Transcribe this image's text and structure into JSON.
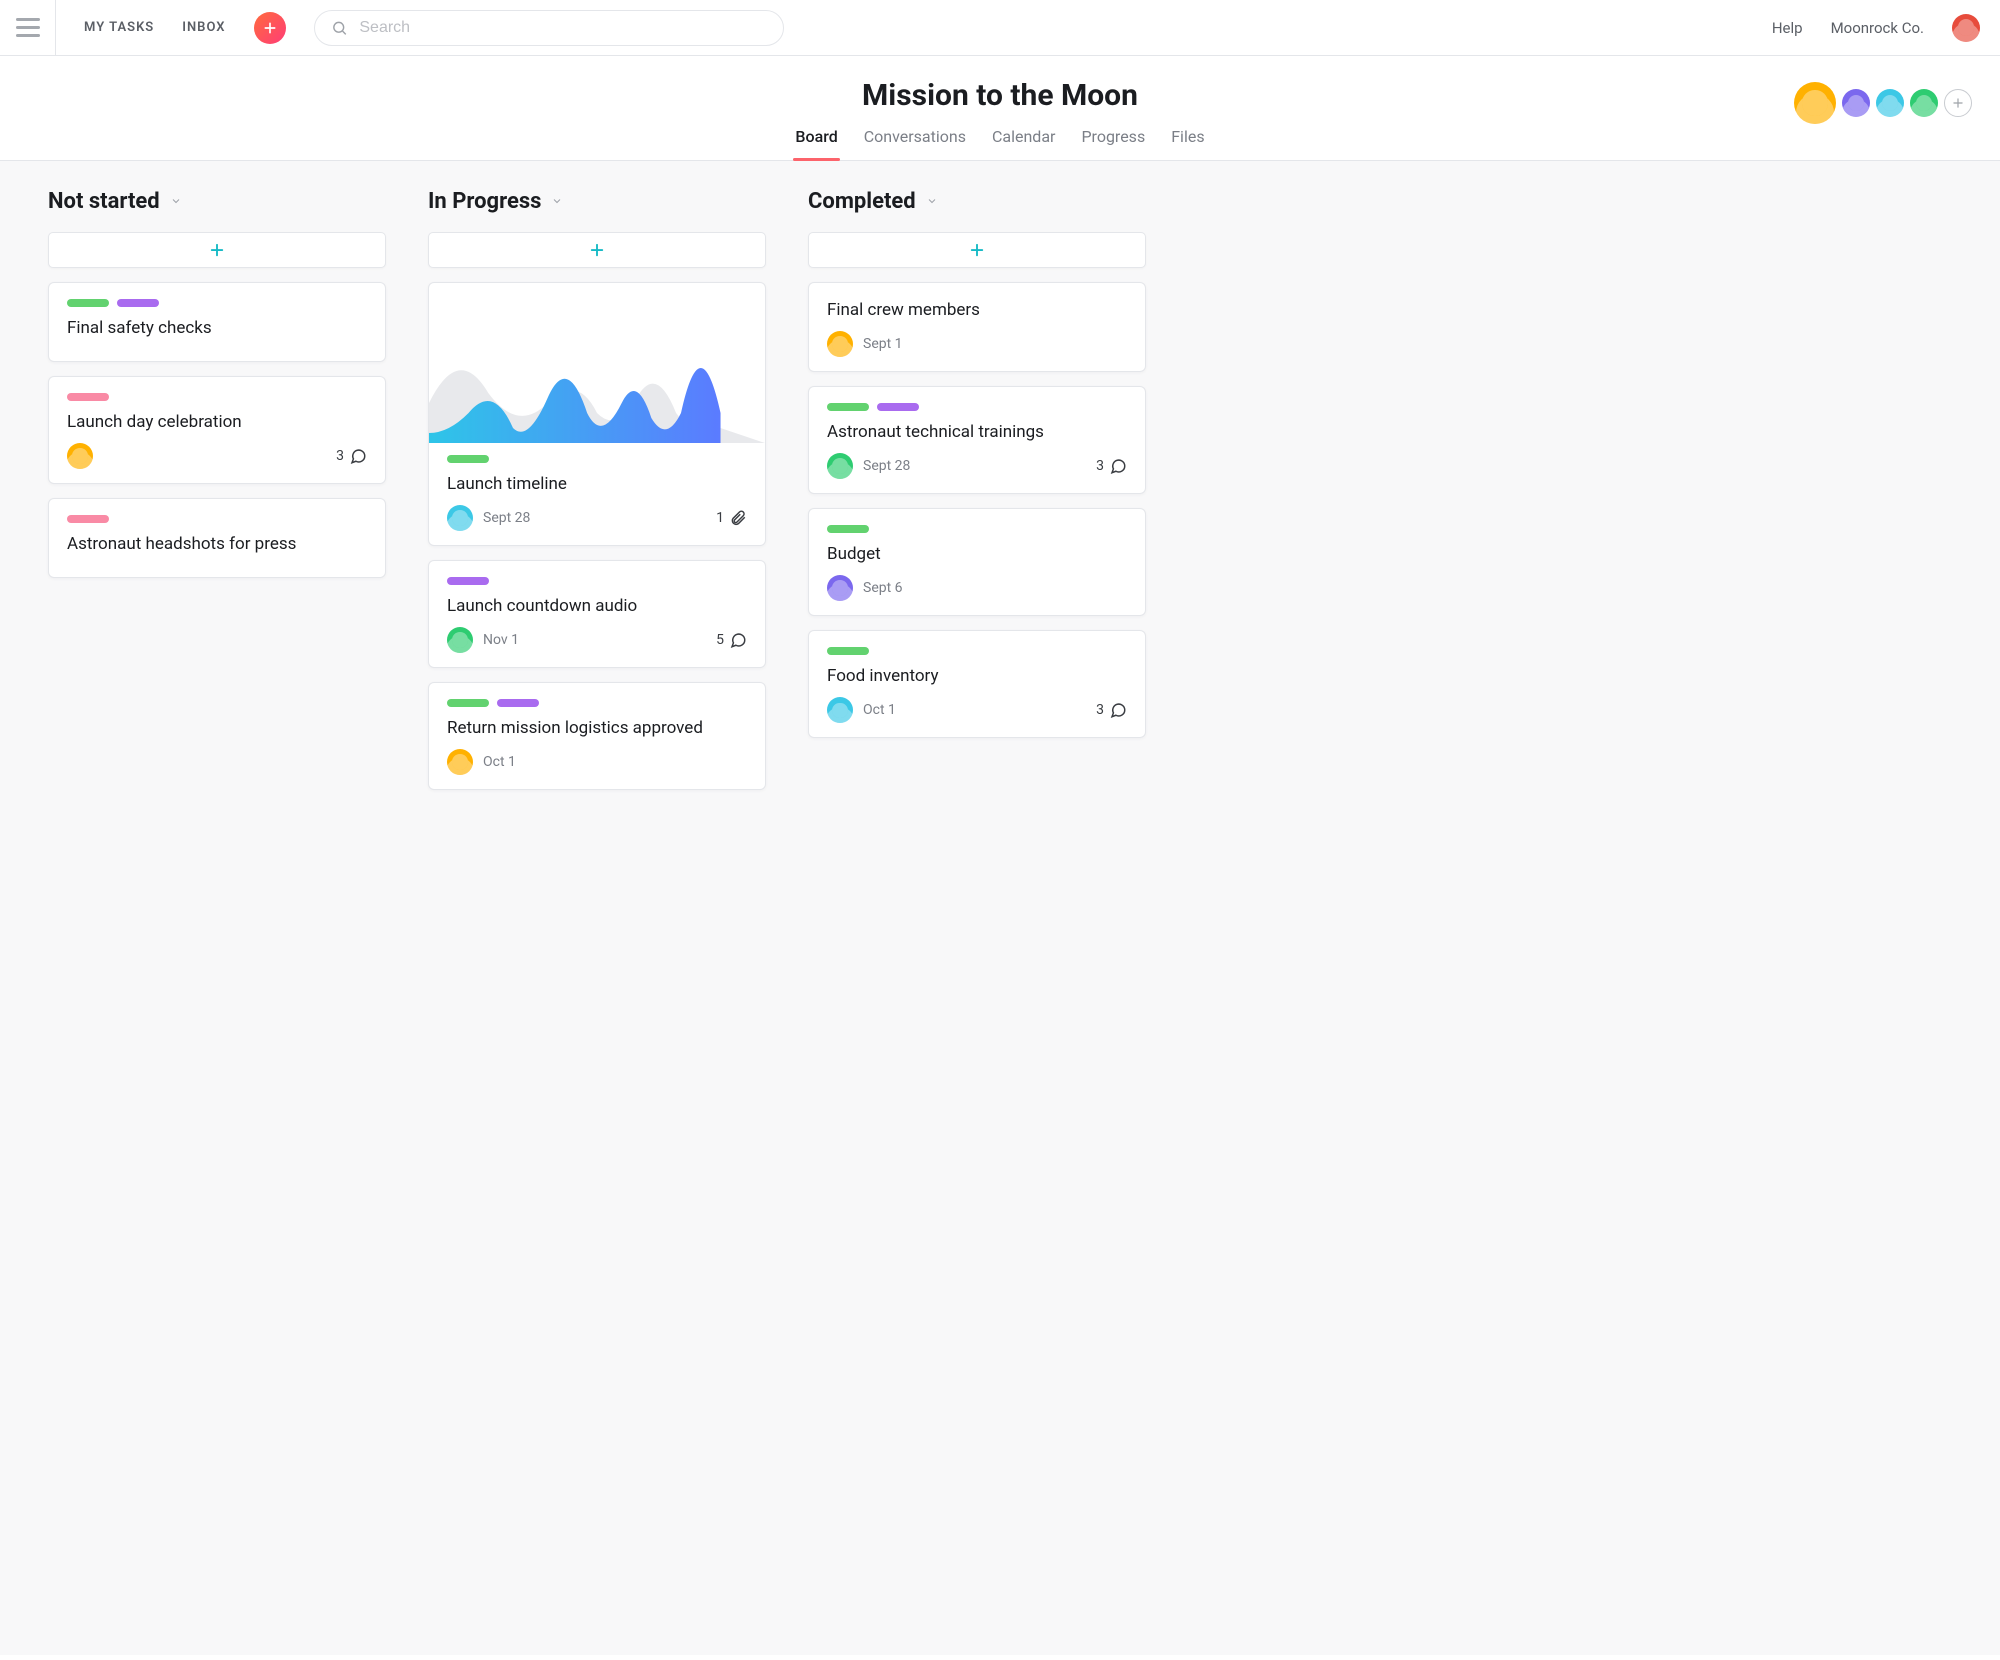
{
  "topnav": {
    "my_tasks": "MY TASKS",
    "inbox": "INBOX",
    "search_placeholder": "Search",
    "help": "Help",
    "workspace": "Moonrock Co."
  },
  "project": {
    "title": "Mission to the Moon",
    "tabs": [
      "Board",
      "Conversations",
      "Calendar",
      "Progress",
      "Files"
    ],
    "active_tab": "Board",
    "member_colors": [
      "#ffb100",
      "#7b68ee",
      "#3cc8e6",
      "#2ecc71"
    ]
  },
  "columns": [
    {
      "name": "Not started",
      "cards": [
        {
          "tags": [
            "green",
            "purple"
          ],
          "title": "Final safety checks"
        },
        {
          "tags": [
            "pink"
          ],
          "title": "Launch day celebration",
          "assignee": "#ffb100",
          "comments": 3
        },
        {
          "tags": [
            "pink"
          ],
          "title": "Astronaut headshots for press"
        }
      ]
    },
    {
      "name": "In Progress",
      "cards": [
        {
          "chart": true,
          "tags": [
            "green"
          ],
          "title": "Launch timeline",
          "assignee": "#3cc8e6",
          "date": "Sept 28",
          "attachments": 1
        },
        {
          "tags": [
            "purple"
          ],
          "title": "Launch countdown audio",
          "assignee": "#2ecc71",
          "date": "Nov 1",
          "comments": 5
        },
        {
          "tags": [
            "green",
            "purple"
          ],
          "title": "Return mission logistics approved",
          "assignee": "#ffb100",
          "date": "Oct 1"
        }
      ]
    },
    {
      "name": "Completed",
      "cards": [
        {
          "title": "Final crew members",
          "assignee": "#ffb100",
          "date": "Sept 1"
        },
        {
          "tags": [
            "green",
            "purple"
          ],
          "title": "Astronaut technical trainings",
          "assignee": "#2ecc71",
          "date": "Sept 28",
          "comments": 3
        },
        {
          "tags": [
            "green"
          ],
          "title": "Budget",
          "assignee": "#7b68ee",
          "date": "Sept 6"
        },
        {
          "tags": [
            "green"
          ],
          "title": "Food inventory",
          "assignee": "#3cc8e6",
          "date": "Oct 1",
          "comments": 3
        }
      ]
    }
  ]
}
